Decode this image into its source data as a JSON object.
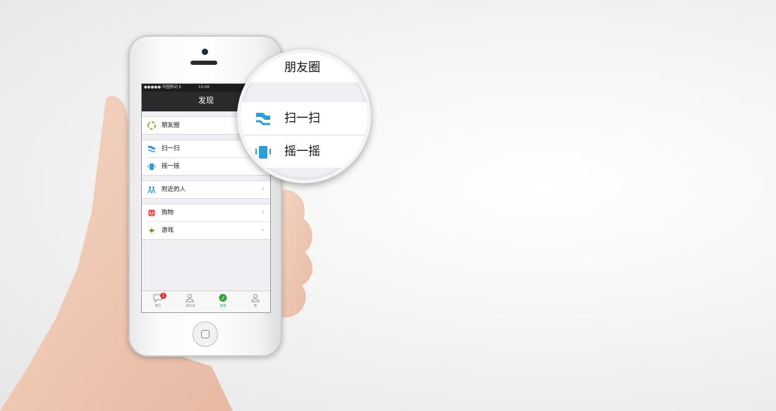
{
  "status_bar": {
    "carrier": "●●●●● 中国移动 E",
    "time": "10:08"
  },
  "nav": {
    "title": "发现"
  },
  "groups": [
    {
      "items": [
        {
          "label": "朋友圈",
          "icon": "moments-icon"
        }
      ]
    },
    {
      "items": [
        {
          "label": "扫一扫",
          "icon": "scan-icon"
        },
        {
          "label": "摇一摇",
          "icon": "shake-icon"
        }
      ]
    },
    {
      "items": [
        {
          "label": "附近的人",
          "icon": "nearby-people-icon"
        }
      ]
    },
    {
      "items": [
        {
          "label": "购物",
          "icon": "shopping-icon"
        },
        {
          "label": "游戏",
          "icon": "games-icon"
        }
      ]
    }
  ],
  "tabs": [
    {
      "label": "微信",
      "icon": "chat-icon",
      "badge": "1"
    },
    {
      "label": "通讯录",
      "icon": "contacts-icon"
    },
    {
      "label": "发现",
      "icon": "discover-icon",
      "active": true
    },
    {
      "label": "我",
      "icon": "me-icon"
    }
  ],
  "magnifier": {
    "items": [
      "朋友圈",
      "扫一扫",
      "摇一摇"
    ]
  },
  "colors": {
    "active_tab": "#2ea33a",
    "badge": "#e5312d",
    "navbar": "#2a2a2c",
    "accent_blue": "#2a9fd8"
  }
}
